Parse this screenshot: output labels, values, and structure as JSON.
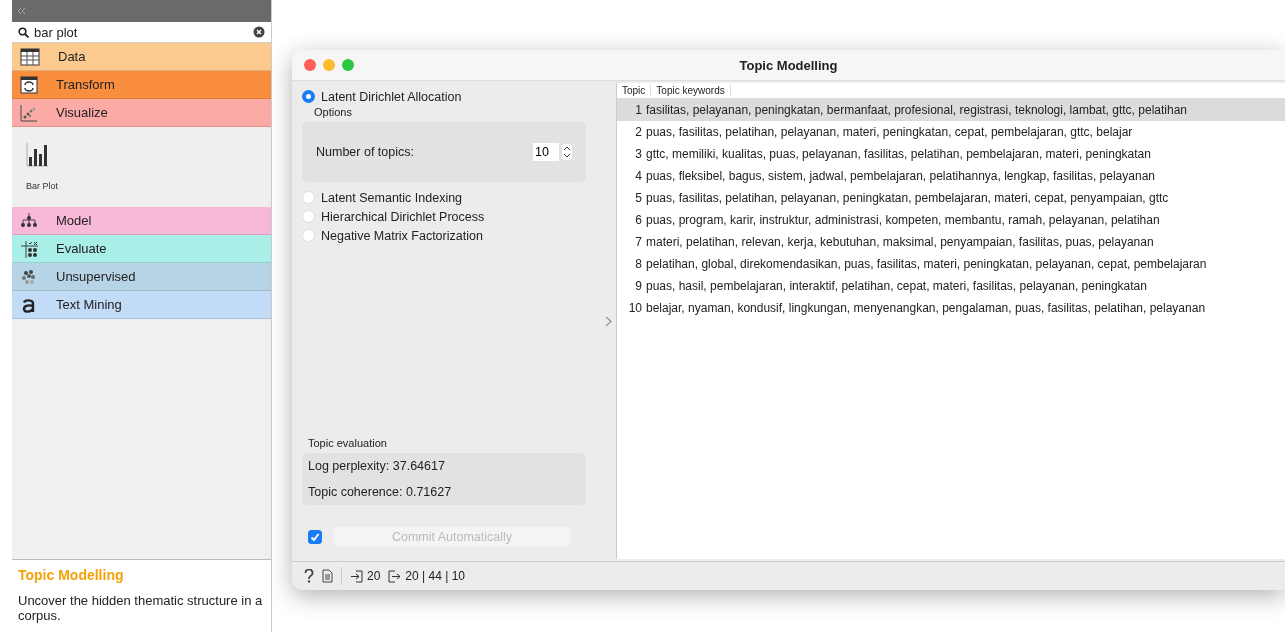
{
  "sidebar": {
    "search": {
      "value": "bar plot"
    },
    "categories": [
      {
        "label": "Data",
        "color": "#fcca8e"
      },
      {
        "label": "Transform",
        "color": "#f98f3e"
      },
      {
        "label": "Visualize",
        "color": "#fbaaa5",
        "widgets": [
          {
            "label": "Bar Plot"
          }
        ]
      },
      {
        "label": "Model",
        "color": "#f8b8d8"
      },
      {
        "label": "Evaluate",
        "color": "#aaeee8"
      },
      {
        "label": "Unsupervised",
        "color": "#b6d4e6"
      },
      {
        "label": "Text Mining",
        "color": "#c2dcf8"
      }
    ],
    "description": {
      "title": "Topic Modelling",
      "text": "Uncover the hidden thematic structure in a corpus."
    }
  },
  "window": {
    "title": "Topic Modelling",
    "methods": [
      {
        "label": "Latent Dirichlet Allocation",
        "selected": true
      },
      {
        "label": "Latent Semantic Indexing",
        "selected": false
      },
      {
        "label": "Hierarchical Dirichlet Process",
        "selected": false
      },
      {
        "label": "Negative Matrix Factorization",
        "selected": false
      }
    ],
    "options": {
      "title": "Options",
      "label": "Number of topics:",
      "value": "10"
    },
    "evaluation": {
      "title": "Topic evaluation",
      "lines": [
        "Log perplexity: 37.64617",
        "Topic coherence: 0.71627"
      ]
    },
    "commit": {
      "checked": true,
      "label": "Commit Automatically",
      "disabled": true
    },
    "table": {
      "columns": [
        "Topic",
        "Topic keywords"
      ],
      "rows": [
        {
          "topic": "1",
          "keywords": "fasilitas, pelayanan, peningkatan, bermanfaat, profesional, registrasi, teknologi, lambat, gttc, pelatihan",
          "selected": true
        },
        {
          "topic": "2",
          "keywords": "puas, fasilitas, pelatihan, pelayanan, materi, peningkatan, cepat, pembelajaran, gttc, belajar",
          "selected": false
        },
        {
          "topic": "3",
          "keywords": "gttc, memiliki, kualitas, puas, pelayanan, fasilitas, pelatihan, pembelajaran, materi, peningkatan",
          "selected": false
        },
        {
          "topic": "4",
          "keywords": "puas, fleksibel, bagus, sistem, jadwal, pembelajaran, pelatihannya, lengkap, fasilitas, pelayanan",
          "selected": false
        },
        {
          "topic": "5",
          "keywords": "puas, fasilitas, pelatihan, pelayanan, peningkatan, pembelajaran, materi, cepat, penyampaian, gttc",
          "selected": false
        },
        {
          "topic": "6",
          "keywords": "puas, program, karir, instruktur, administrasi, kompeten, membantu, ramah, pelayanan, pelatihan",
          "selected": false
        },
        {
          "topic": "7",
          "keywords": "materi, pelatihan, relevan, kerja, kebutuhan, maksimal, penyampaian, fasilitas, puas, pelayanan",
          "selected": false
        },
        {
          "topic": "8",
          "keywords": "pelatihan, global, direkomendasikan, puas, fasilitas, materi, peningkatan, pelayanan, cepat, pembelajaran",
          "selected": false
        },
        {
          "topic": "9",
          "keywords": "puas, hasil, pembelajaran, interaktif, pelatihan, cepat, materi, fasilitas, pelayanan, peningkatan",
          "selected": false
        },
        {
          "topic": "10",
          "keywords": "belajar, nyaman, kondusif, lingkungan, menyenangkan, pengalaman, puas, fasilitas, pelatihan, pelayanan",
          "selected": false
        }
      ]
    },
    "status": {
      "input": "20",
      "output": "20 | 44 | 10"
    }
  }
}
